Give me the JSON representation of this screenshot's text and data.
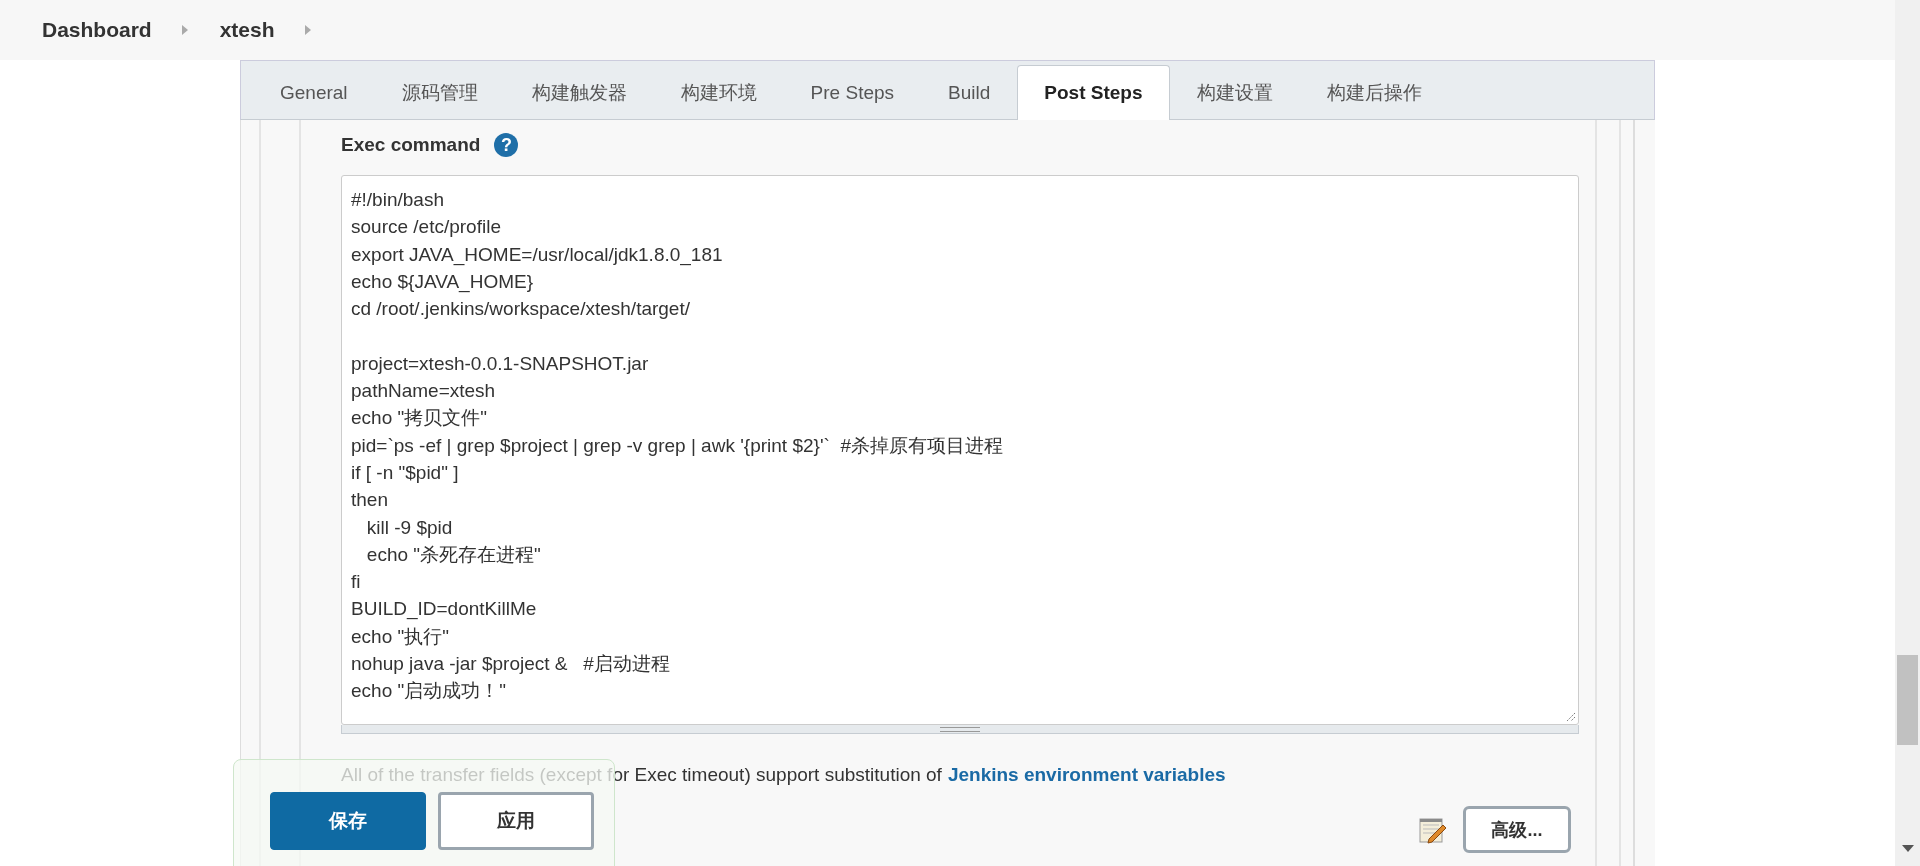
{
  "breadcrumbs": [
    {
      "label": "Dashboard"
    },
    {
      "label": "xtesh"
    }
  ],
  "tabs": [
    {
      "label": "General",
      "selected": false
    },
    {
      "label": "源码管理",
      "selected": false
    },
    {
      "label": "构建触发器",
      "selected": false
    },
    {
      "label": "构建环境",
      "selected": false
    },
    {
      "label": "Pre Steps",
      "selected": false
    },
    {
      "label": "Build",
      "selected": false
    },
    {
      "label": "Post Steps",
      "selected": true
    },
    {
      "label": "构建设置",
      "selected": false
    },
    {
      "label": "构建后操作",
      "selected": false
    }
  ],
  "exec_command": {
    "label": "Exec command",
    "help": "?",
    "blocks": [
      [
        "#!/bin/bash",
        "source /etc/profile",
        "export JAVA_HOME=/usr/local/jdk1.8.0_181",
        "echo ${JAVA_HOME}",
        "cd /root/.jenkins/workspace/xtesh/target/"
      ],
      [
        "project=xtesh-0.0.1-SNAPSHOT.jar",
        "pathName=xtesh",
        "echo \"拷贝文件\"",
        "pid=`ps -ef | grep $project | grep -v grep | awk '{print $2}'`  #杀掉原有项目进程",
        "if [ -n \"$pid\" ]",
        "then",
        "   kill -9 $pid",
        "   echo \"杀死存在进程\"",
        "fi",
        "BUILD_ID=dontKillMe",
        "echo \"执行\"",
        "nohup java -jar $project &   #启动进程",
        "echo \"启动成功！\""
      ]
    ]
  },
  "note": {
    "text": "All of the transfer fields (except for Exec timeout) support substitution of",
    "link": "Jenkins environment variables"
  },
  "advanced_button": "高级...",
  "bottom_bar": {
    "buttons": [
      {
        "label": "保存",
        "kind": "primary"
      },
      {
        "label": "应用",
        "kind": "secondary"
      }
    ]
  }
}
